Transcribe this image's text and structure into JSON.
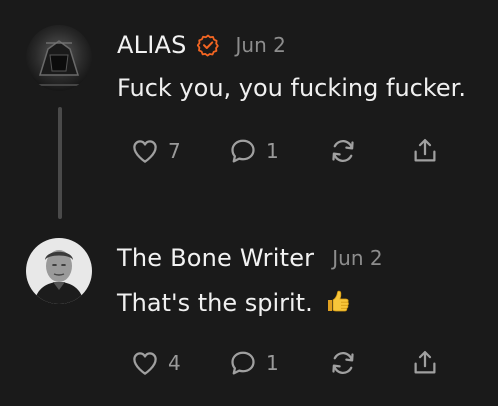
{
  "comments": [
    {
      "author": "ALIAS",
      "verified": true,
      "date": "Jun 2",
      "text": "Fuck you, you fucking fucker.",
      "likes": "7",
      "replies": "1",
      "avatar": "dark-avatar-icon"
    },
    {
      "author": "The Bone Writer",
      "verified": false,
      "date": "Jun 2",
      "text": "That's the spirit.",
      "emoji": "thumbs-up-emoji",
      "likes": "4",
      "replies": "1",
      "avatar": "user-photo"
    }
  ],
  "colors": {
    "background": "#1a1a1a",
    "verified_badge": "#f26522",
    "muted_text": "#8d8d8d"
  }
}
